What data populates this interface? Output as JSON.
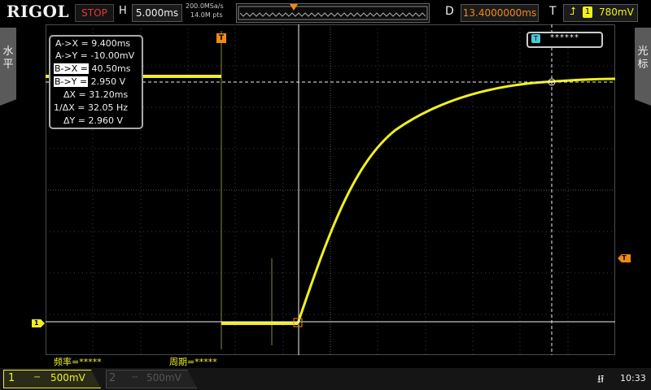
{
  "header": {
    "brand": "RIGOL",
    "run_status": "STOP",
    "horizontal_label": "H",
    "timebase": "5.000ms",
    "sample_rate": "200.0MSa/s",
    "memory_depth": "14.0M pts",
    "delay_label": "D",
    "trigger_delay": "13.4000000ms",
    "trigger_label": "T",
    "trigger_source": "1",
    "trigger_level": "780mV"
  },
  "side_tabs": {
    "left": "水平",
    "right": "光标"
  },
  "cursor_readout": {
    "rows": [
      {
        "label": "A->X =",
        "value": "9.400ms",
        "highlight": false
      },
      {
        "label": "A->Y =",
        "value": "-10.00mV",
        "highlight": false
      },
      {
        "label": "B->X =",
        "value": "40.50ms",
        "highlight": true
      },
      {
        "label": "B->Y =",
        "value": "2.950 V",
        "highlight": true
      },
      {
        "label": "ΔX =",
        "value": "31.20ms",
        "highlight": false
      },
      {
        "label": "1/ΔX =",
        "value": "32.05 Hz",
        "highlight": false
      },
      {
        "label": "ΔY =",
        "value": "2.960 V",
        "highlight": false
      }
    ]
  },
  "notification": {
    "icon": "T",
    "text": "******"
  },
  "markers": {
    "trigger_time": "T",
    "trigger_level": "T",
    "channel1": "1"
  },
  "measurements": {
    "frequency": "频率=*****",
    "period": "周期=*****"
  },
  "channels": [
    {
      "number": "1",
      "coupling": "⎓",
      "scale": "500mV",
      "active": true
    },
    {
      "number": "2",
      "coupling": "⎓",
      "scale": "500mV",
      "active": false
    }
  ],
  "status": {
    "usb_icon": "usb-icon",
    "time": "10:33"
  },
  "colors": {
    "channel1": "#f0f020",
    "trigger": "#f08a17",
    "stop": "#e33333",
    "grid": "#3c3c3c"
  }
}
